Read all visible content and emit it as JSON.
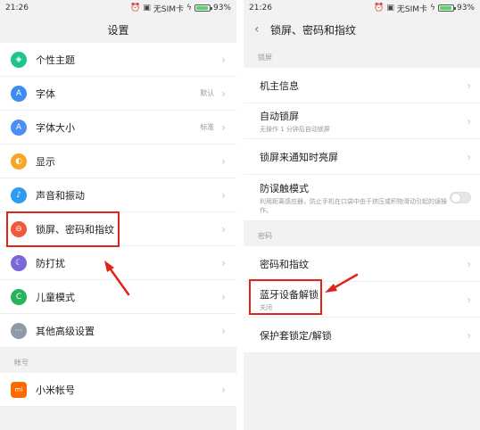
{
  "accent_red": "#e0241b",
  "left": {
    "status": {
      "time": "21:26",
      "sim": "无SIM卡",
      "battery": "93%"
    },
    "title": "设置",
    "items": [
      {
        "label": "个性主题",
        "value": "",
        "icon": "theme-icon",
        "glyph": "◈",
        "color": "#1ec48b"
      },
      {
        "label": "字体",
        "value": "默认",
        "icon": "font-icon",
        "glyph": "A",
        "color": "#3f8cf0"
      },
      {
        "label": "字体大小",
        "value": "标准",
        "icon": "font-size-icon",
        "glyph": "A",
        "color": "#4a8ff1"
      },
      {
        "label": "显示",
        "value": "",
        "icon": "display-icon",
        "glyph": "◐",
        "color": "#f5a623"
      },
      {
        "label": "声音和振动",
        "value": "",
        "icon": "sound-icon",
        "glyph": "♪",
        "color": "#2e9bf0"
      },
      {
        "label": "锁屏、密码和指纹",
        "value": "",
        "icon": "lock-icon",
        "glyph": "⊖",
        "color": "#f05a3a"
      },
      {
        "label": "防打扰",
        "value": "",
        "icon": "moon-icon",
        "glyph": "☾",
        "color": "#7b68d8"
      },
      {
        "label": "儿童模式",
        "value": "",
        "icon": "child-icon",
        "glyph": "C",
        "color": "#27b25c"
      },
      {
        "label": "其他高级设置",
        "value": "",
        "icon": "more-icon",
        "glyph": "···",
        "color": "#8e9aa8"
      }
    ],
    "section_account": "帐号",
    "account_items": [
      {
        "label": "小米帐号",
        "icon": "mi-account-icon",
        "glyph": "mi",
        "color": "#ff6a00"
      }
    ]
  },
  "right": {
    "status": {
      "time": "21:26",
      "sim": "无SIM卡",
      "battery": "93%"
    },
    "title": "锁屏、密码和指纹",
    "section_lock": "锁屏",
    "lock_items": [
      {
        "label": "机主信息",
        "sub": ""
      },
      {
        "label": "自动锁屏",
        "sub": "无操作 1 分钟后自动锁屏"
      },
      {
        "label": "锁屏来通知时亮屏",
        "sub": ""
      },
      {
        "label": "防误触模式",
        "sub": "利用距离感应器，防止手机在口袋中由于挤压或积物滑动引起的误操作。"
      }
    ],
    "section_password": "密码",
    "password_items": [
      {
        "label": "密码和指纹",
        "sub": ""
      },
      {
        "label": "蓝牙设备解锁",
        "sub": "关闭"
      },
      {
        "label": "保护套锁定/解锁",
        "sub": ""
      }
    ]
  }
}
